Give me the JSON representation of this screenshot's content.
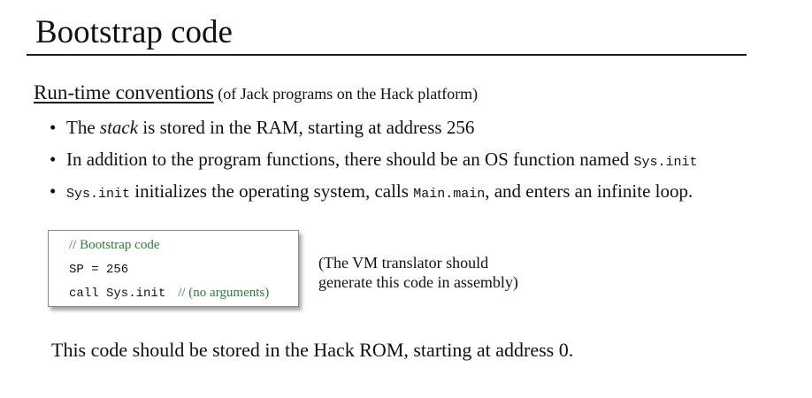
{
  "title": "Bootstrap code",
  "section": {
    "heading": "Run-time conventions",
    "note": " (of Jack programs on the Hack platform)"
  },
  "bullets": [
    {
      "text_1": "The ",
      "em": "stack",
      "text_2": " is stored in the RAM, starting at address 256"
    },
    {
      "text": "In addition to the program functions, there should be an OS function named ",
      "code": "Sys.init"
    },
    {
      "code_1": "Sys.init",
      "text_1": " initializes the operating system, calls ",
      "code_2": "Main.main",
      "text_2": ", and enters an infinite loop."
    }
  ],
  "code_box": {
    "comment": "// Bootstrap code",
    "line_1": "SP = 256",
    "line_2": "call Sys.init",
    "line_2_comment": "// (no arguments)"
  },
  "side_note": {
    "line_1": "(The VM translator should",
    "line_2": "generate this code in assembly)"
  },
  "footer": "This code should be stored in the Hack ROM, starting at address 0.",
  "colors": {
    "comment": "#2e7d32",
    "text": "#111111"
  }
}
